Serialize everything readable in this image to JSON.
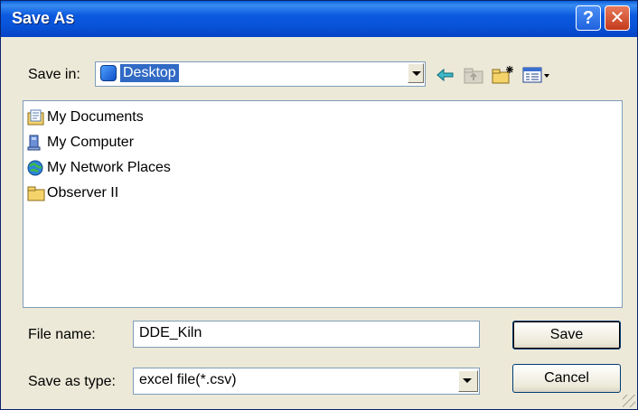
{
  "window": {
    "title": "Save As"
  },
  "titlebar": {
    "help_glyph": "?",
    "close_glyph": "✕"
  },
  "save_in": {
    "label": "Save in:",
    "value": "Desktop",
    "icon": "desktop-icon"
  },
  "toolbar": {
    "back_icon": "back-arrow-icon",
    "up_icon": "up-folder-icon",
    "new_folder_icon": "new-folder-icon",
    "views_icon": "views-menu-icon"
  },
  "files": [
    {
      "name": "My Documents",
      "icon": "my-documents-icon"
    },
    {
      "name": "My Computer",
      "icon": "my-computer-icon"
    },
    {
      "name": "My Network Places",
      "icon": "network-places-icon"
    },
    {
      "name": "Observer II",
      "icon": "folder-icon"
    }
  ],
  "file_name": {
    "label": "File name:",
    "value": "DDE_Kiln"
  },
  "save_type": {
    "label": "Save as type:",
    "value": "excel file(*.csv)"
  },
  "buttons": {
    "save": "Save",
    "cancel": "Cancel"
  },
  "colors": {
    "title_bar": "#0853d8",
    "selection": "#316ac5",
    "dialog_bg": "#ece9d8"
  }
}
